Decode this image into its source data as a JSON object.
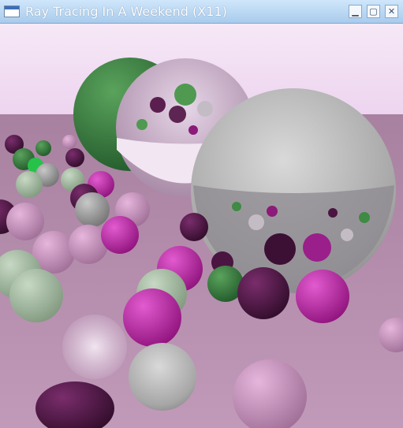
{
  "window": {
    "title": "Ray Tracing In A Weekend (X11)",
    "icon": "window-app-icon",
    "controls": [
      {
        "name": "minimize-button",
        "glyph": "▁"
      },
      {
        "name": "maximize-button",
        "glyph": "▢"
      },
      {
        "name": "close-button",
        "glyph": "✕"
      }
    ]
  },
  "colors": {
    "titlebar_top": "#cfe6fb",
    "titlebar_bottom": "#a9cbec",
    "sky": "#f3e2f5",
    "ground": "#b98fb4",
    "magenta": "#c21aa8",
    "dark_purple": "#4a1540",
    "green": "#2f7a3a",
    "grey": "#8f8f8f"
  }
}
